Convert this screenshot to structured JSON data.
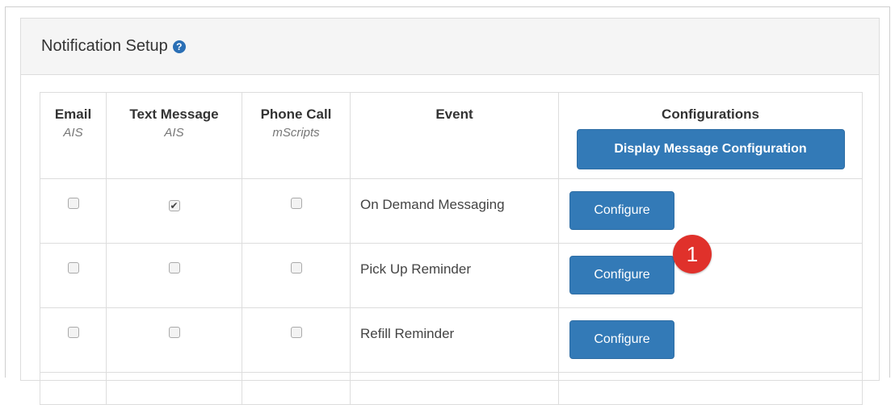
{
  "panel": {
    "title": "Notification Setup",
    "help_icon": "question-circle-icon",
    "help_glyph": "?"
  },
  "table": {
    "headers": [
      {
        "label": "Email",
        "sub": "AIS"
      },
      {
        "label": "Text Message",
        "sub": "AIS"
      },
      {
        "label": "Phone Call",
        "sub": "mScripts"
      },
      {
        "label": "Event",
        "sub": ""
      },
      {
        "label": "Configurations",
        "sub": ""
      }
    ],
    "display_button": "Display Message Configuration",
    "rows": [
      {
        "email": false,
        "text": true,
        "phone": false,
        "event": "On Demand Messaging",
        "button": "Configure"
      },
      {
        "email": false,
        "text": false,
        "phone": false,
        "event": "Pick Up Reminder",
        "button": "Configure"
      },
      {
        "email": false,
        "text": false,
        "phone": false,
        "event": "Refill Reminder",
        "button": "Configure"
      }
    ]
  },
  "callout": {
    "number": "1"
  },
  "colors": {
    "primary_button": "#337ab7",
    "callout": "#e0312b",
    "help_icon": "#2a6fb5"
  }
}
